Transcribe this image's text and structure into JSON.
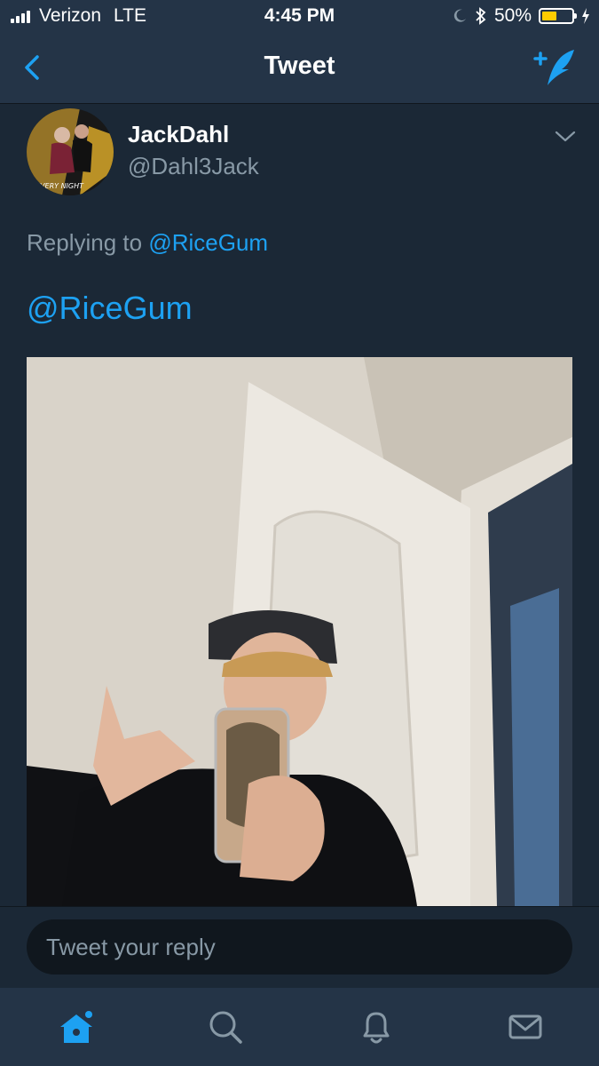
{
  "status_bar": {
    "carrier": "Verizon",
    "network": "LTE",
    "time": "4:45 PM",
    "battery_percent": "50%",
    "battery_level": 0.5,
    "icons": [
      "signal-icon",
      "moon-icon",
      "bluetooth-icon",
      "battery-icon",
      "charging-icon"
    ]
  },
  "nav": {
    "title": "Tweet",
    "back_icon": "chevron-left-icon",
    "compose_icon": "compose-tweet-icon"
  },
  "tweet": {
    "display_name": "JackDahl",
    "handle": "@Dahl3Jack",
    "replying_prefix": "Replying to",
    "replying_to": "@RiceGum",
    "text": "@RiceGum",
    "menu_icon": "chevron-down-icon"
  },
  "reply": {
    "placeholder": "Tweet your reply"
  },
  "tabs": [
    {
      "icon": "home-icon",
      "active": true
    },
    {
      "icon": "search-icon",
      "active": false
    },
    {
      "icon": "notifications-bell-icon",
      "active": false
    },
    {
      "icon": "messages-envelope-icon",
      "active": false
    }
  ],
  "colors": {
    "background": "#1b2836",
    "bar": "#243447",
    "accent": "#1da1f2",
    "muted": "#8899a6"
  }
}
